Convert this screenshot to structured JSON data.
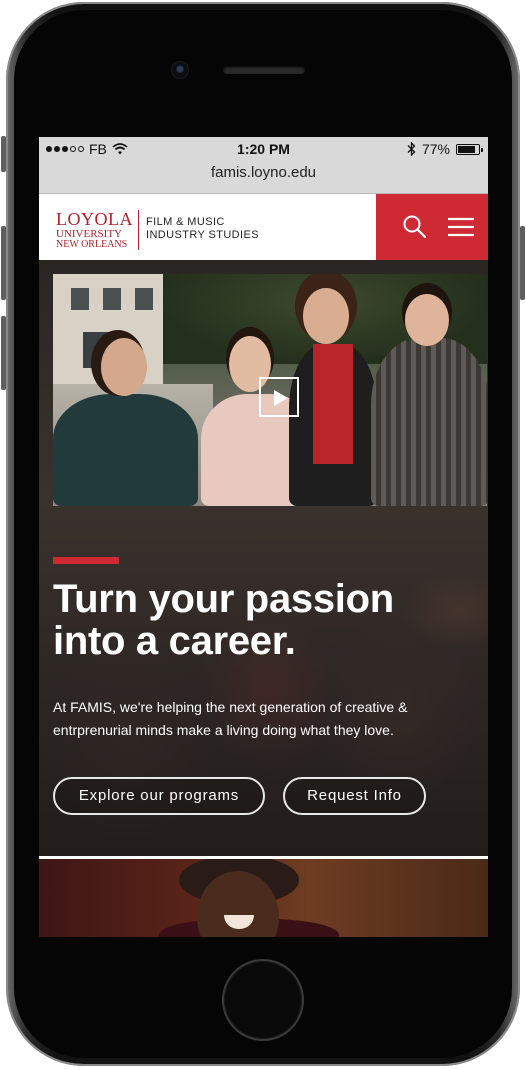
{
  "status_bar": {
    "carrier": "FB",
    "time": "1:20 PM",
    "battery_percent": "77%",
    "battery_level": 0.77,
    "signal_dots_filled": 3,
    "signal_dots_total": 5,
    "icons": [
      "wifi-icon",
      "bluetooth-icon",
      "battery-icon"
    ]
  },
  "browser": {
    "url": "famis.loyno.edu"
  },
  "header": {
    "logo": {
      "line1": "LOYOLA",
      "line2": "UNIVERSITY",
      "line3": "NEW ORLEANS",
      "program_line1": "FILM & MUSIC",
      "program_line2": "INDUSTRY STUDIES"
    },
    "icons": {
      "search": "search-icon",
      "menu": "hamburger-menu-icon"
    },
    "accent_color": "#cf2a33"
  },
  "hero": {
    "video_icon": "play-icon",
    "title_line1": "Turn your passion",
    "title_line2": "into a career.",
    "body_line1": "At FAMIS, we're helping the next generation of creative &",
    "body_line2": "entrprenurial minds make a living doing what they love.",
    "buttons": {
      "explore": "Explore our programs",
      "request": "Request Info"
    }
  }
}
